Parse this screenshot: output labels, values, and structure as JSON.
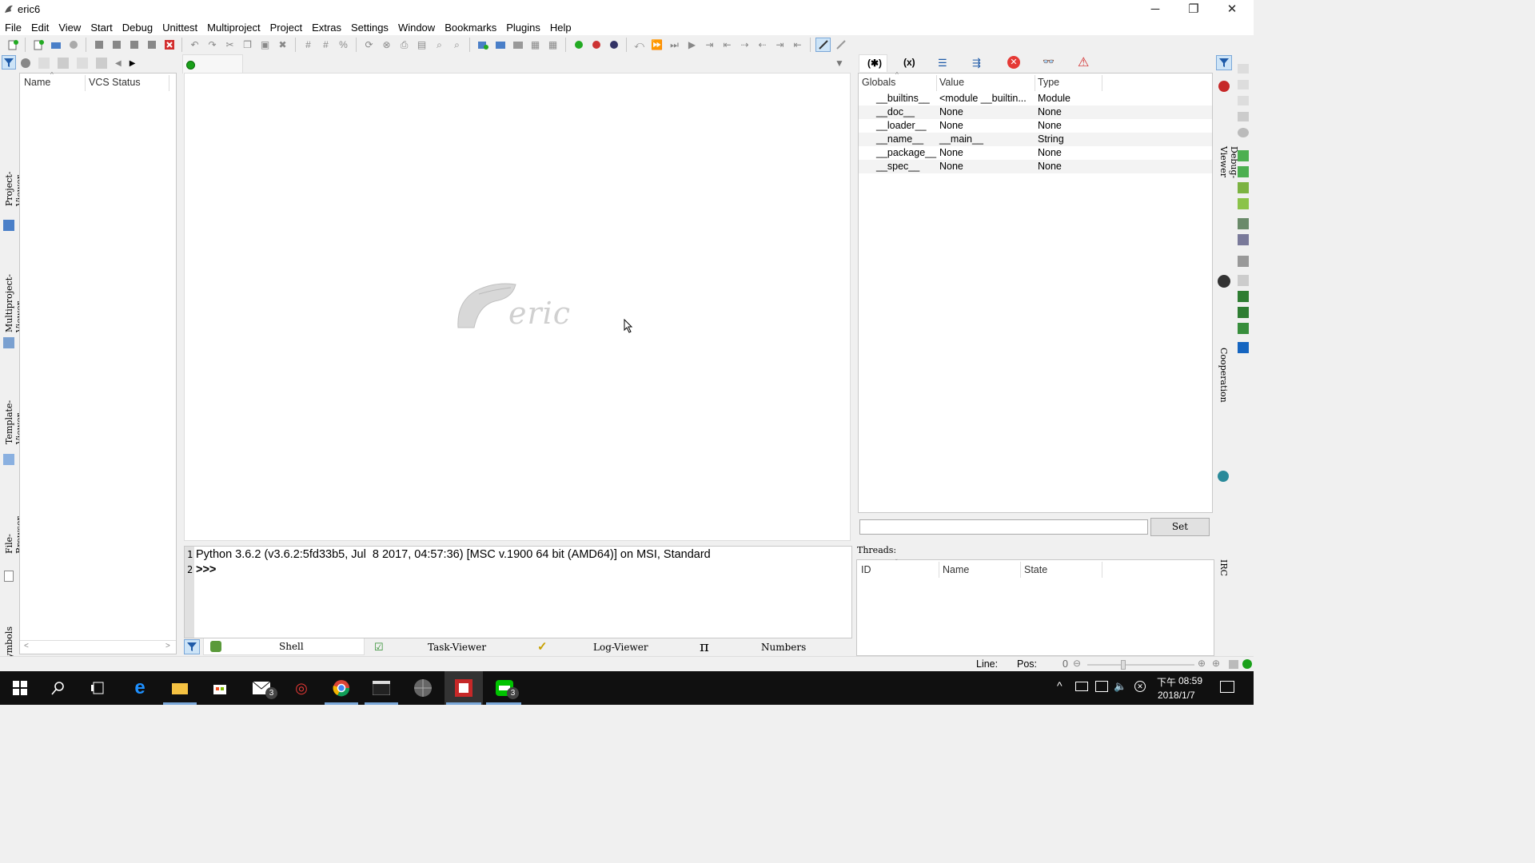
{
  "window": {
    "title": "eric6"
  },
  "menu": [
    "File",
    "Edit",
    "View",
    "Start",
    "Debug",
    "Unittest",
    "Multiproject",
    "Project",
    "Extras",
    "Settings",
    "Window",
    "Bookmarks",
    "Plugins",
    "Help"
  ],
  "left_tabs": [
    "Project-Viewer",
    "Multiproject-Viewer",
    "Template-Viewer",
    "File-Browser",
    "Symbols"
  ],
  "project_viewer": {
    "columns": [
      "Name",
      "VCS Status"
    ]
  },
  "editor": {
    "logo_text": "eric"
  },
  "variables": {
    "columns": [
      "Globals",
      "Value",
      "Type"
    ],
    "rows": [
      [
        "__builtins__",
        "<module __builtin...",
        "Module"
      ],
      [
        "__doc__",
        "None",
        "None"
      ],
      [
        "__loader__",
        "None",
        "None"
      ],
      [
        "__name__",
        "__main__",
        "String"
      ],
      [
        "__package__",
        "None",
        "None"
      ],
      [
        "__spec__",
        "None",
        "None"
      ]
    ],
    "set_button": "Set"
  },
  "threads": {
    "label": "Threads:",
    "columns": [
      "ID",
      "Name",
      "State"
    ]
  },
  "right_tabs": [
    "Debug-Viewer",
    "Cooperation",
    "IRC"
  ],
  "shell": {
    "line1_no": "1",
    "line1": "Python 3.6.2 (v3.6.2:5fd33b5, Jul  8 2017, 04:57:36) [MSC v.1900 64 bit (AMD64)] on MSI, Standard",
    "line2_no": "2",
    "line2": ">>>"
  },
  "bottom_tabs": [
    "Shell",
    "Task-Viewer",
    "Log-Viewer",
    "Numbers"
  ],
  "statusbar": {
    "line_label": "Line:",
    "pos_label": "Pos:",
    "zoom": "0"
  },
  "taskbar": {
    "time": "08:59",
    "ampm": "下午",
    "date": "2018/1/7",
    "mail_badge": "3",
    "line_badge": "3"
  },
  "colors": {
    "accent": "#0078d7",
    "number": "#2e8b8b",
    "error": "#d32f2f"
  }
}
